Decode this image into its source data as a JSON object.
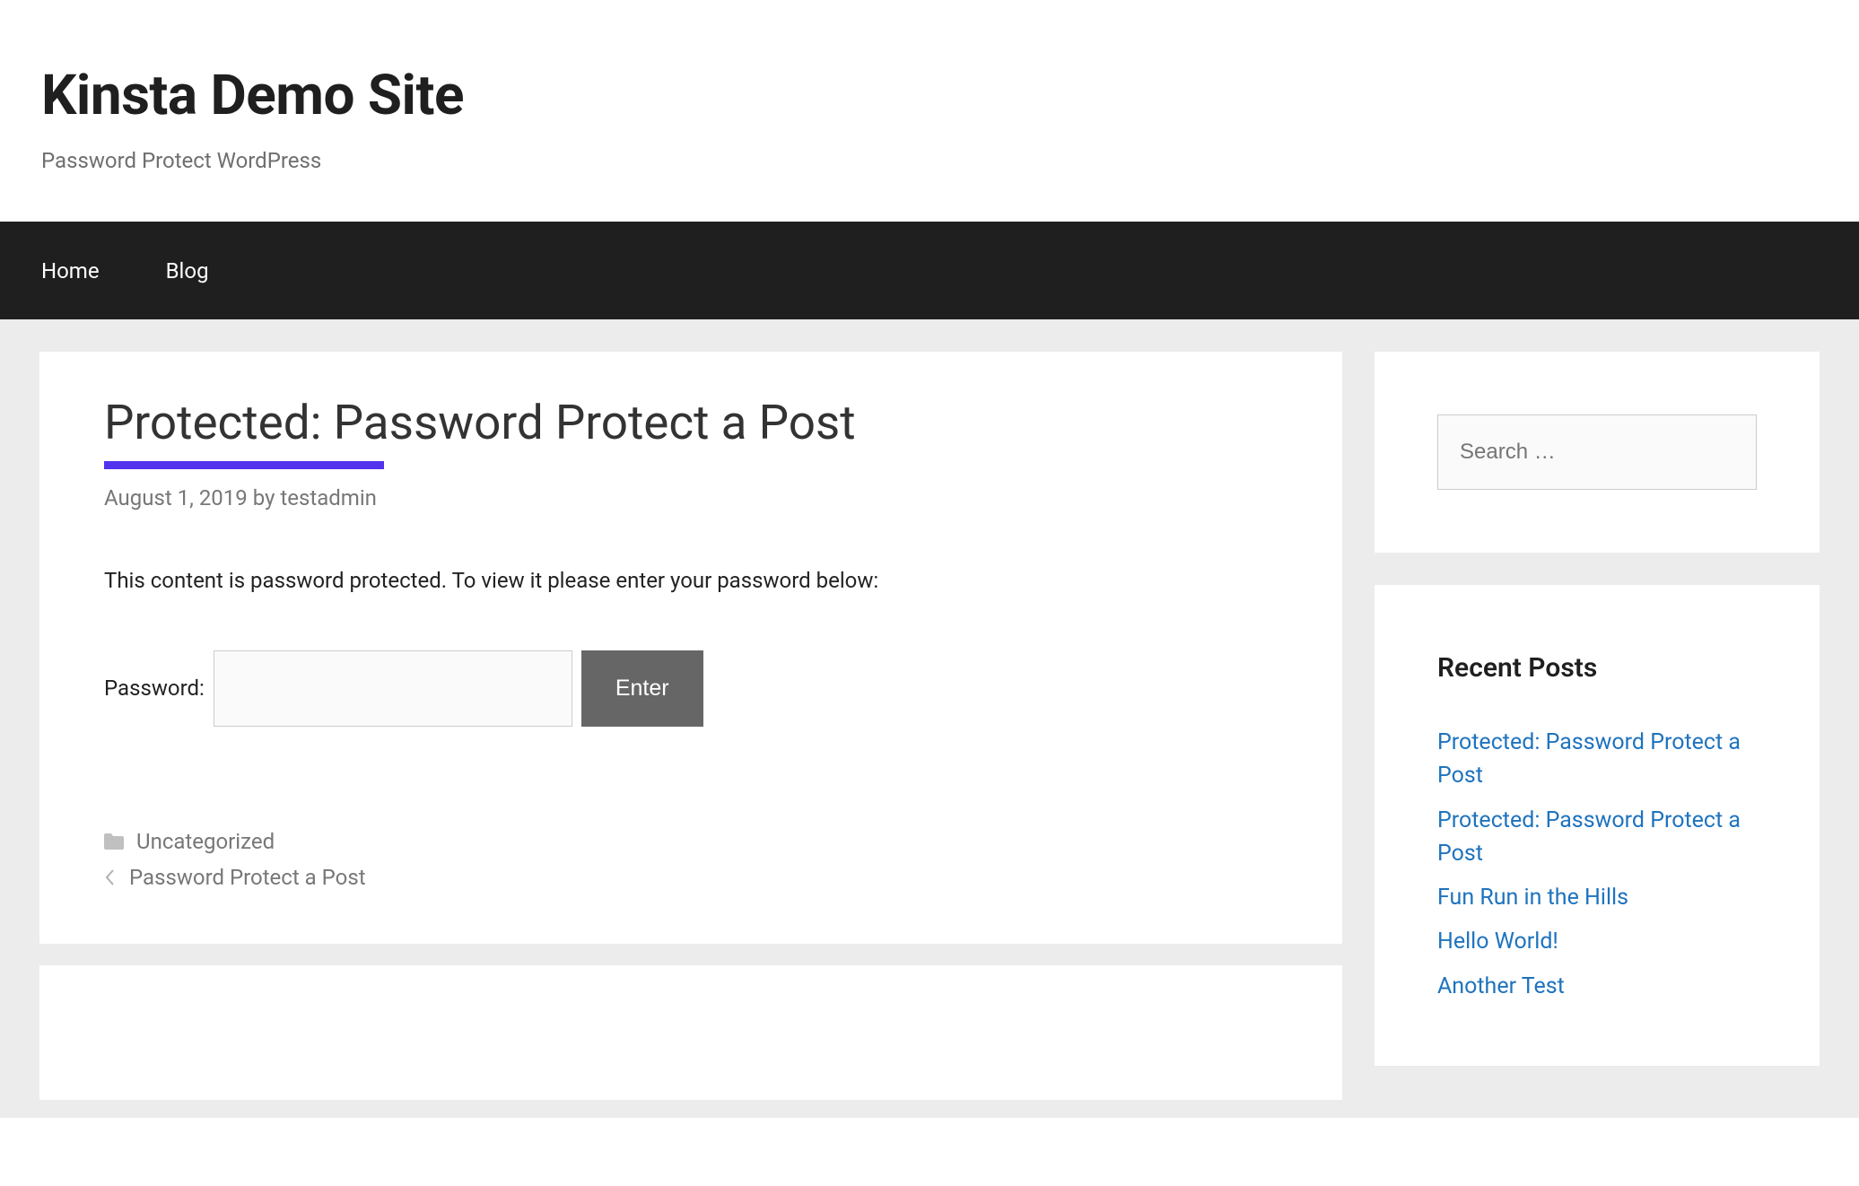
{
  "header": {
    "title": "Kinsta Demo Site",
    "tagline": "Password Protect WordPress"
  },
  "nav": {
    "items": [
      "Home",
      "Blog"
    ]
  },
  "post": {
    "title": "Protected: Password Protect a Post",
    "date": "August 1, 2019",
    "by_label": "by",
    "author": "testadmin",
    "protected_message": "This content is password protected. To view it please enter your password below:",
    "password_label": "Password:",
    "password_value": "",
    "submit_label": "Enter"
  },
  "footer_meta": {
    "category": "Uncategorized",
    "prev_post": "Password Protect a Post"
  },
  "sidebar": {
    "search_placeholder": "Search …",
    "recent_title": "Recent Posts",
    "recent_posts": [
      "Protected: Password Protect a Post",
      "Protected: Password Protect a Post",
      "Fun Run in the Hills",
      "Hello World!",
      "Another Test"
    ]
  }
}
